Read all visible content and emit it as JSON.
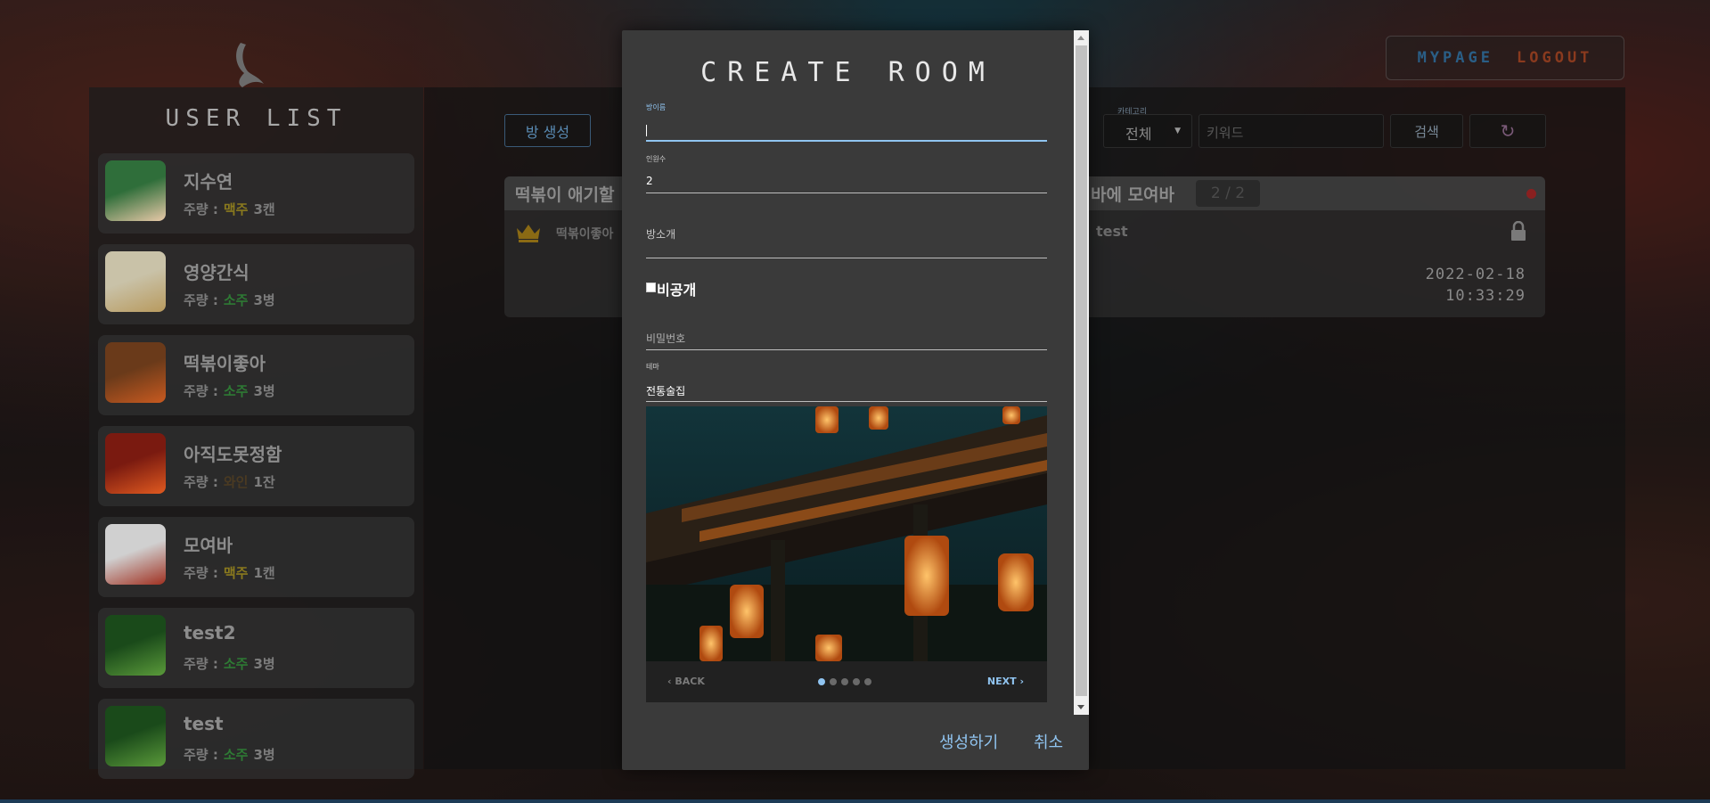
{
  "nav": {
    "mypage": "MYPAGE",
    "logout": "LOGOUT"
  },
  "user_list": {
    "title": "USER LIST",
    "drink_prefix": "주량 :",
    "users": [
      {
        "name": "지수연",
        "drink": "맥주",
        "drink_color": "#8a7a1e",
        "amount": "3캔"
      },
      {
        "name": "영양간식",
        "drink": "소주",
        "drink_color": "#2e7a34",
        "amount": "3병"
      },
      {
        "name": "떡볶이좋아",
        "drink": "소주",
        "drink_color": "#2e7a34",
        "amount": "3병"
      },
      {
        "name": "아직도못정함",
        "drink": "와인",
        "drink_color": "#4a3a22",
        "amount": "1잔"
      },
      {
        "name": "모여바",
        "drink": "맥주",
        "drink_color": "#8a7a1e",
        "amount": "1캔"
      },
      {
        "name": "test2",
        "drink": "소주",
        "drink_color": "#2e7a34",
        "amount": "3병"
      },
      {
        "name": "test",
        "drink": "소주",
        "drink_color": "#2e7a34",
        "amount": "3병"
      }
    ]
  },
  "toolbar": {
    "create_label": "방 생성",
    "category_label": "카테고리",
    "category_value": "전체",
    "keyword_placeholder": "키워드",
    "search_label": "검색",
    "refresh_icon": "↻"
  },
  "room": {
    "title_left": "떡볶이 애기할",
    "title_right": "바에 모여바",
    "count": "2 / 2",
    "host": "떡볶이좋아",
    "user": "test",
    "date": "2022-02-18",
    "time": "10:33:29"
  },
  "modal": {
    "title": "CREATE ROOM",
    "room_name_label": "방이름",
    "room_name_value": "",
    "capacity_label": "인원수",
    "capacity_value": "2",
    "intro_placeholder": "방소개",
    "private_label": "비공개",
    "password_placeholder": "비밀번호",
    "theme_label": "테마",
    "theme_value": "전통술집",
    "carousel": {
      "back": "BACK",
      "next": "NEXT",
      "slide_count": 5,
      "active_slide": 1
    },
    "submit": "생성하기",
    "cancel": "취소"
  }
}
